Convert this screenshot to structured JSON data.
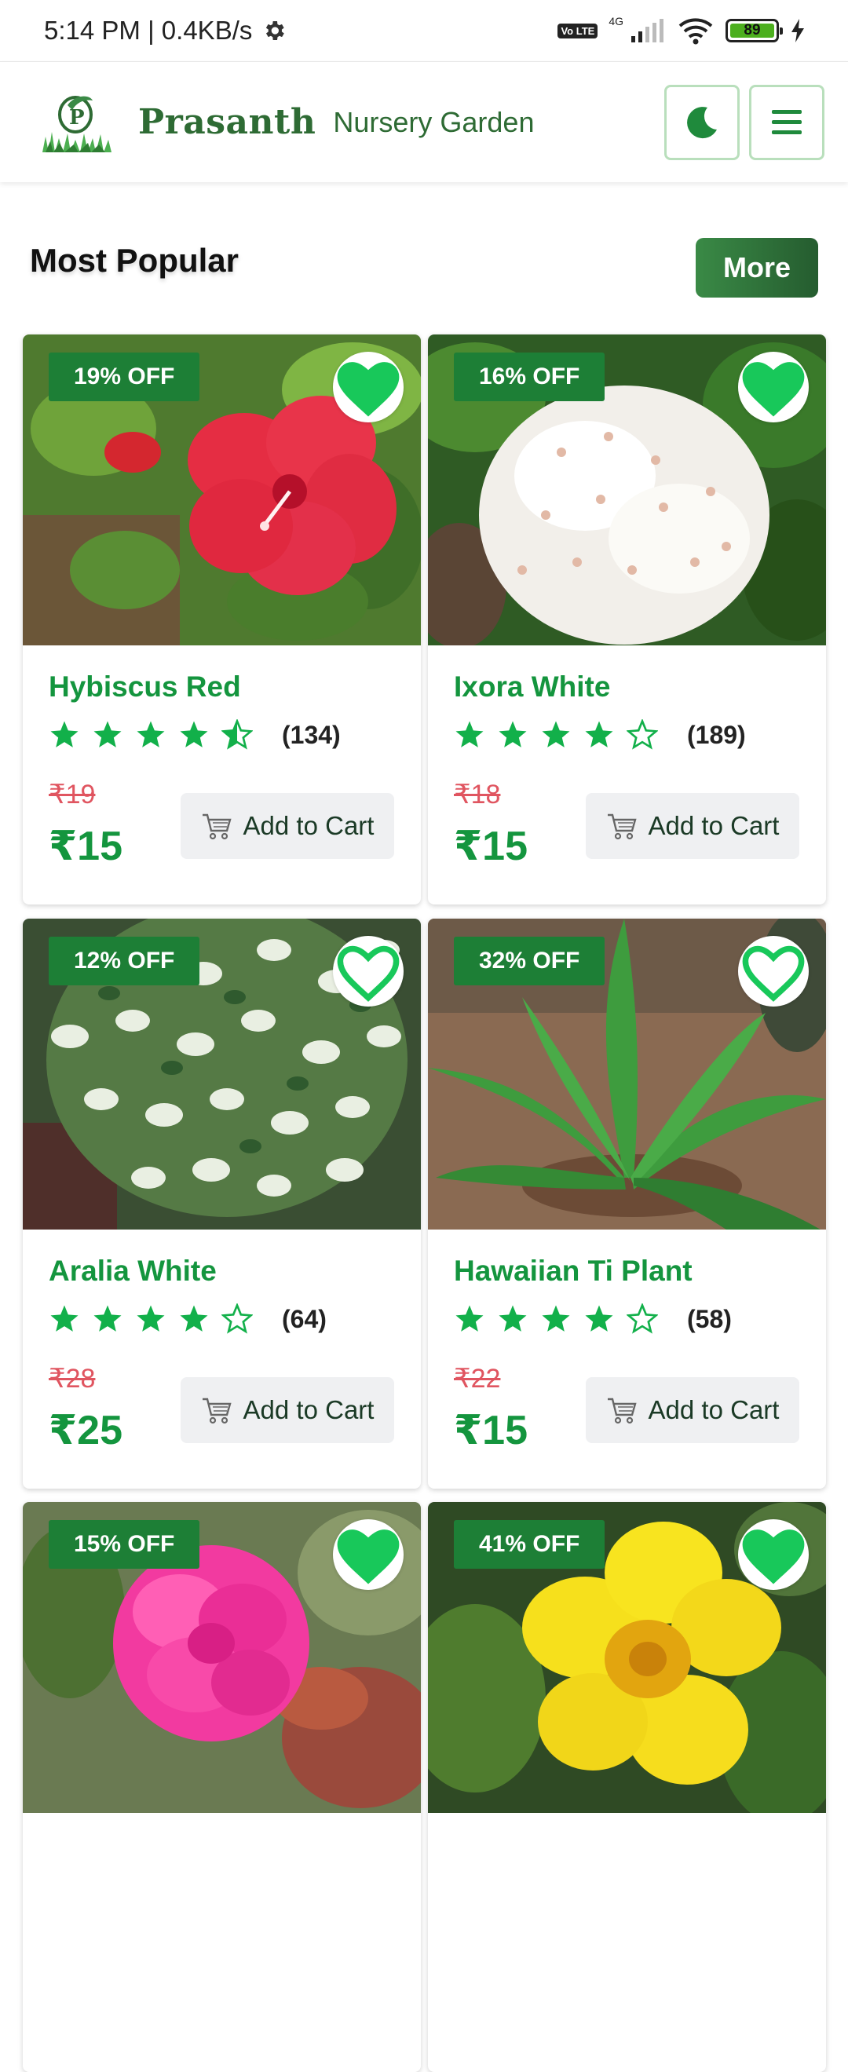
{
  "status_bar": {
    "time_speed": "5:14 PM | 0.4KB/s",
    "volte": "Vo LTE",
    "network": "4G",
    "battery": "89"
  },
  "header": {
    "brand_name": "Prasanth",
    "brand_sub": "Nursery Garden"
  },
  "section": {
    "title": "Most Popular",
    "more_label": "More"
  },
  "products": [
    {
      "name": "Hybiscus Red",
      "discount": "19% OFF",
      "rating": 4.5,
      "rating_count": "(134)",
      "old_price": "₹19",
      "price": "₹15",
      "favorited": true,
      "cart_label": "Add to Cart"
    },
    {
      "name": "Ixora White",
      "discount": "16% OFF",
      "rating": 4,
      "rating_count": "(189)",
      "old_price": "₹18",
      "price": "₹15",
      "favorited": true,
      "cart_label": "Add to Cart"
    },
    {
      "name": "Aralia White",
      "discount": "12% OFF",
      "rating": 4,
      "rating_count": "(64)",
      "old_price": "₹28",
      "price": "₹25",
      "favorited": false,
      "cart_label": "Add to Cart"
    },
    {
      "name": "Hawaiian Ti Plant",
      "discount": "32% OFF",
      "rating": 4,
      "rating_count": "(58)",
      "old_price": "₹22",
      "price": "₹15",
      "favorited": false,
      "cart_label": "Add to Cart"
    },
    {
      "name": "",
      "discount": "15% OFF",
      "favorited": true
    },
    {
      "name": "",
      "discount": "41% OFF",
      "favorited": true
    }
  ],
  "colors": {
    "brand_green": "#2e6b34",
    "accent_green": "#14953e",
    "badge_green": "#1d7f36",
    "heart_green": "#18c85a",
    "old_price_red": "#e05560"
  },
  "icons": [
    "settings-icon",
    "moon-icon",
    "menu-icon",
    "heart-icon",
    "star-icon",
    "cart-icon"
  ]
}
